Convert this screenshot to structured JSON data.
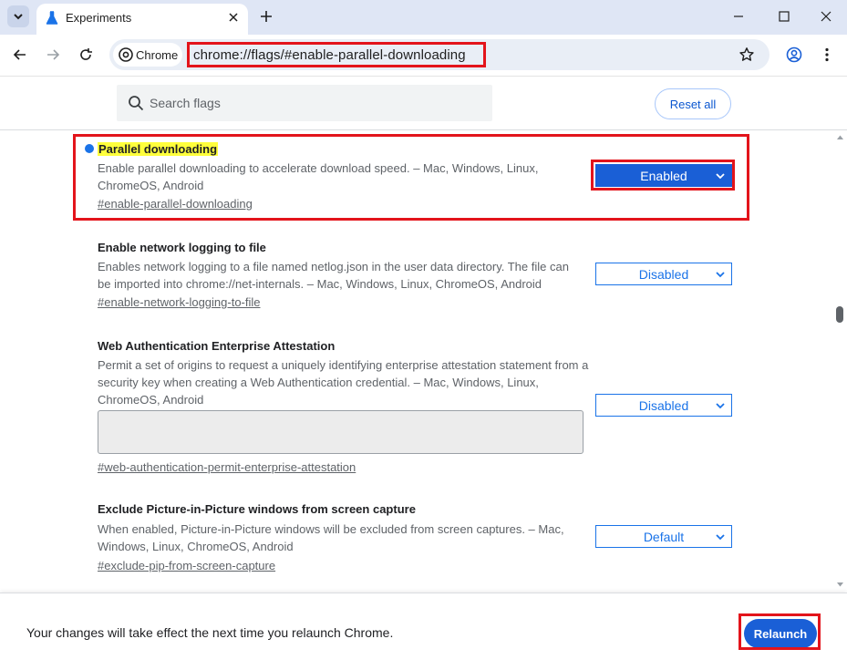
{
  "browser": {
    "tab_title": "Experiments",
    "chip_label": "Chrome",
    "url_scheme": "chrome://",
    "url_host": "flags",
    "url_rest": "/#enable-parallel-downloading",
    "icons": {
      "tab_search": "chevron-down-icon",
      "favicon": "flask-icon",
      "close": "close-icon",
      "new_tab": "plus-icon",
      "back": "back-arrow-icon",
      "forward": "forward-arrow-icon",
      "reload": "reload-icon",
      "bookmark": "star-icon",
      "profile": "profile-icon",
      "menu": "kebab-menu-icon"
    }
  },
  "flags_header": {
    "search_placeholder": "Search flags",
    "reset_label": "Reset all"
  },
  "flags": [
    {
      "title": "Parallel downloading",
      "description": "Enable parallel downloading to accelerate download speed. – Mac, Windows, Linux, ChromeOS, Android",
      "link": "#enable-parallel-downloading",
      "value": "Enabled",
      "modified": true
    },
    {
      "title": "Enable network logging to file",
      "description": "Enables network logging to a file named netlog.json in the user data directory. The file can be imported into chrome://net-internals. – Mac, Windows, Linux, ChromeOS, Android",
      "link": "#enable-network-logging-to-file",
      "value": "Disabled"
    },
    {
      "title": "Web Authentication Enterprise Attestation",
      "description": "Permit a set of origins to request a uniquely identifying enterprise attestation statement from a security key when creating a Web Authentication credential. – Mac, Windows, Linux, ChromeOS, Android",
      "link": "#web-authentication-permit-enterprise-attestation",
      "value": "Disabled",
      "textarea_value": ""
    },
    {
      "title": "Exclude Picture-in-Picture windows from screen capture",
      "description": "When enabled, Picture-in-Picture windows will be excluded from screen captures. – Mac, Windows, Linux, ChromeOS, Android",
      "link": "#exclude-pip-from-screen-capture",
      "value": "Default"
    }
  ],
  "bottom_bar": {
    "message": "Your changes will take effect the next time you relaunch Chrome.",
    "relaunch_label": "Relaunch"
  },
  "colors": {
    "accent": "#1a5fd6",
    "highlight": "#ffff3c",
    "annotation_red": "#e3141b"
  }
}
